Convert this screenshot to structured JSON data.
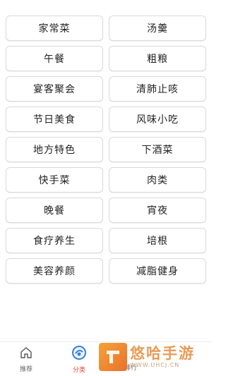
{
  "categories": [
    "家常菜",
    "汤羹",
    "午餐",
    "粗粮",
    "宴客聚会",
    "清肺止咳",
    "节日美食",
    "风味小吃",
    "地方特色",
    "下酒菜",
    "快手菜",
    "肉类",
    "晚餐",
    "宵夜",
    "食疗养生",
    "培根",
    "美容养颜",
    "减脂健身"
  ],
  "tabbar": {
    "home_label": "推荐",
    "category_label": "分类",
    "rank_label": "排行",
    "active_color": "#e8453c",
    "home_icon": "home-icon",
    "category_icon": "category-icon"
  },
  "watermark": {
    "main": "悠哈手游",
    "sub": "WWW.UHCJ.CN"
  }
}
